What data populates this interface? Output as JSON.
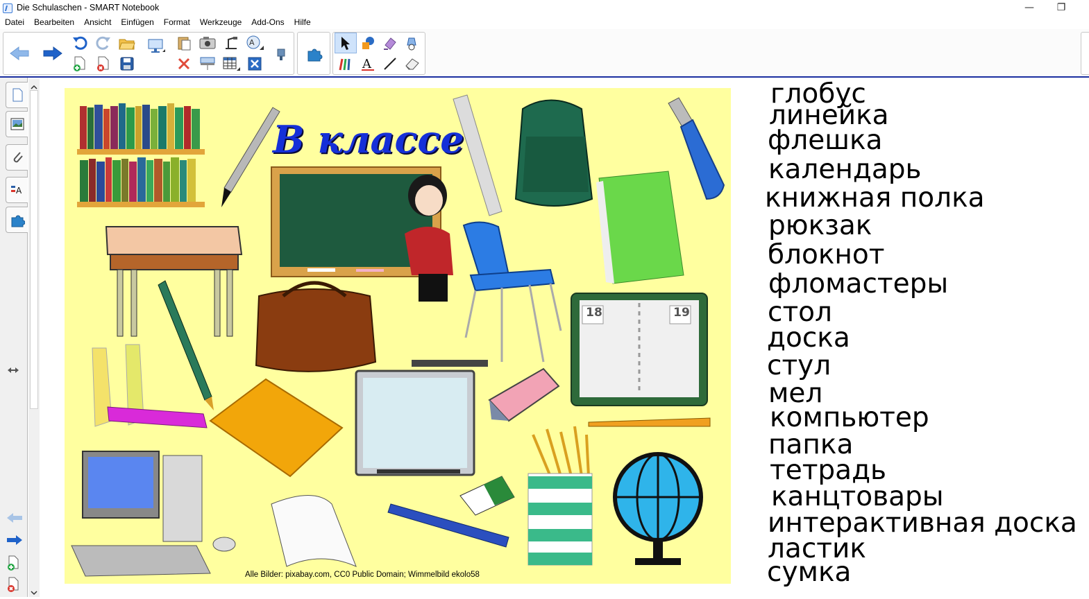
{
  "window": {
    "title": "Die Schulaschen - SMART Notebook",
    "minimize": "—",
    "restore": "❐"
  },
  "menu": [
    "Datei",
    "Bearbeiten",
    "Ansicht",
    "Einfügen",
    "Format",
    "Werkzeuge",
    "Add-Ons",
    "Hilfe"
  ],
  "toolbar_icons": {
    "back": "back-arrow-icon",
    "forward": "forward-arrow-icon",
    "undo": "undo-icon",
    "redo": "redo-icon",
    "open": "open-folder-icon",
    "add_page": "add-page-icon",
    "delete_page": "delete-page-icon",
    "save": "save-icon",
    "screen": "presentation-screen-icon",
    "paste": "paste-icon",
    "camera": "screen-capture-icon",
    "delete": "delete-x-icon",
    "screen_shade": "screen-shade-icon",
    "document_camera": "document-camera-icon",
    "table": "table-icon",
    "spell": "spell-check-icon",
    "full_screen": "full-screen-icon",
    "addons": "puzzle-icon",
    "select": "select-pointer-icon",
    "shapes": "shapes-icon",
    "eraser_tool": "creative-pen-icon",
    "fill": "fill-icon",
    "pens": "pens-icon",
    "text": "text-icon",
    "line": "line-icon",
    "eraser": "eraser-icon"
  },
  "colors": {
    "accent": "#1a2fa0",
    "poster_bg": "#ffff9f",
    "title_blue": "#1530d8"
  },
  "poster": {
    "title": "В классе",
    "credit": "Alle Bilder: pixabay.com, CC0 Public Domain; Wimmelbild ekolo58"
  },
  "words": [
    "глобус",
    "линейка",
    "флешка",
    "календарь",
    "книжная полка",
    "рюкзак",
    "блокнот",
    "фломастеры",
    "стол",
    "доска",
    "стул",
    "мел",
    "компьютер",
    "папка",
    "тетрадь",
    "канцтовары",
    "интерактивная доска",
    "ластик",
    "сумка"
  ],
  "calendar": {
    "left_day": "18",
    "right_day": "19"
  }
}
